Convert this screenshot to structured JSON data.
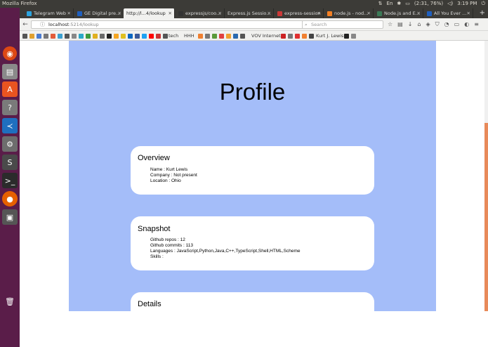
{
  "system_bar": {
    "window_title": "Mozilla Firefox",
    "keyboard": "En",
    "battery": "(2:31, 76%)",
    "time": "3:19 PM"
  },
  "tabs": [
    {
      "label": "Telegram Web",
      "fav_color": "#2ca5e0"
    },
    {
      "label": "GE Digital pre...",
      "fav_color": "#1f5fbf"
    },
    {
      "label": "http://l...4/lookup",
      "fav_color": "#cfcfcf"
    },
    {
      "label": "expressjs/coo...",
      "fav_color": "#333333"
    },
    {
      "label": "Express.js Sessio...",
      "fav_color": "#999999"
    },
    {
      "label": "express-session",
      "fav_color": "#cb3837"
    },
    {
      "label": "node.js - nod...",
      "fav_color": "#f48024"
    },
    {
      "label": "Node.js and E...",
      "fav_color": "#3b7a57"
    },
    {
      "label": "All You Ever ...",
      "fav_color": "#1f5fbf"
    }
  ],
  "address_bar": {
    "host": "localhost",
    "path": ":5214/lookup"
  },
  "search_bar": {
    "placeholder": "Search"
  },
  "bookmarks": {
    "tech": "tech",
    "hhh": "HHH",
    "vov": "VOV Internet",
    "kurt": "Kurt J. Lewis"
  },
  "page": {
    "title": "Profile",
    "cards": [
      {
        "heading": "Overview",
        "lines": [
          "Name : Kurt Lewis",
          "Company : Not present",
          "Location : Ohio"
        ]
      },
      {
        "heading": "Snapshot",
        "lines": [
          "Github repos : 12",
          "Github commits : 113",
          "Languages : JavaScript,Python,Java,C++,TypeScript,Shell,HTML,Scheme",
          "Skills :"
        ]
      },
      {
        "heading": "Details",
        "lines": []
      }
    ]
  },
  "colors": {
    "page_background": "#a4bdf9",
    "card_background": "#ffffff",
    "launcher": "#5a1d49"
  },
  "icons": [
    "ubuntu-icon",
    "files-icon",
    "software-center-icon",
    "help-icon",
    "vscode-icon",
    "settings-icon",
    "sublime-icon",
    "terminal-icon",
    "firefox-icon",
    "screen-lock-icon",
    "trash-icon"
  ]
}
